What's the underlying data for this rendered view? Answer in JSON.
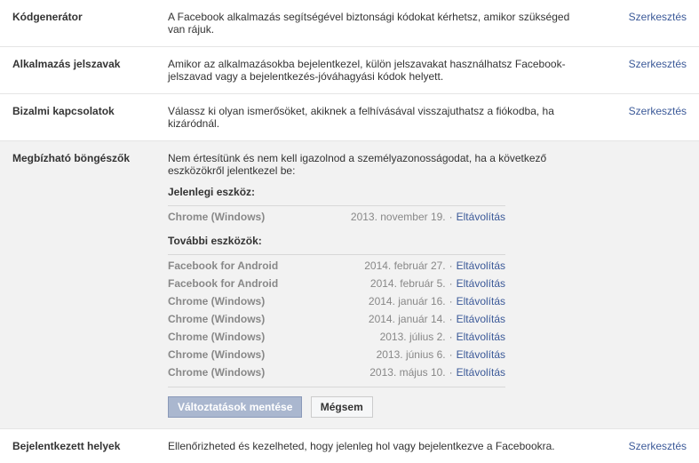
{
  "rows": {
    "kod": {
      "label": "Kódgenerátor",
      "desc": "A Facebook alkalmazás segítségével biztonsági kódokat kérhetsz, amikor szükséged van rájuk.",
      "action": "Szerkesztés"
    },
    "alk": {
      "label": "Alkalmazás jelszavak",
      "desc": "Amikor az alkalmazásokba bejelentkezel, külön jelszavakat használhatsz Facebook-jelszavad vagy a bejelentkezés-jóváhagyási kódok helyett.",
      "action": "Szerkesztés"
    },
    "biz": {
      "label": "Bizalmi kapcsolatok",
      "desc": "Válassz ki olyan ismerősöket, akiknek a felhívásával visszajuthatsz a fiókodba, ha kizáródnál.",
      "action": "Szerkesztés"
    },
    "bej": {
      "label": "Bejelentkezett helyek",
      "desc": "Ellenőrizheted és kezelheted, hogy jelenleg hol vagy bejelentkezve a Facebookra.",
      "action": "Szerkesztés"
    }
  },
  "trusted": {
    "label": "Megbízható böngészők",
    "intro": "Nem értesítünk és nem kell igazolnod a személyazonosságodat, ha a következő eszközökről jelentkezel be:",
    "current_header": "Jelenlegi eszköz:",
    "current": {
      "name": "Chrome (Windows)",
      "date": "2013. november 19.",
      "remove": "Eltávolítás"
    },
    "other_header": "További eszközök:",
    "others": [
      {
        "name": "Facebook for Android",
        "date": "2014. február 27.",
        "remove": "Eltávolítás"
      },
      {
        "name": "Facebook for Android",
        "date": "2014. február 5.",
        "remove": "Eltávolítás"
      },
      {
        "name": "Chrome (Windows)",
        "date": "2014. január 16.",
        "remove": "Eltávolítás"
      },
      {
        "name": "Chrome (Windows)",
        "date": "2014. január 14.",
        "remove": "Eltávolítás"
      },
      {
        "name": "Chrome (Windows)",
        "date": "2013. július 2.",
        "remove": "Eltávolítás"
      },
      {
        "name": "Chrome (Windows)",
        "date": "2013. június 6.",
        "remove": "Eltávolítás"
      },
      {
        "name": "Chrome (Windows)",
        "date": "2013. május 10.",
        "remove": "Eltávolítás"
      }
    ],
    "save": "Változtatások mentése",
    "cancel": "Mégsem"
  }
}
